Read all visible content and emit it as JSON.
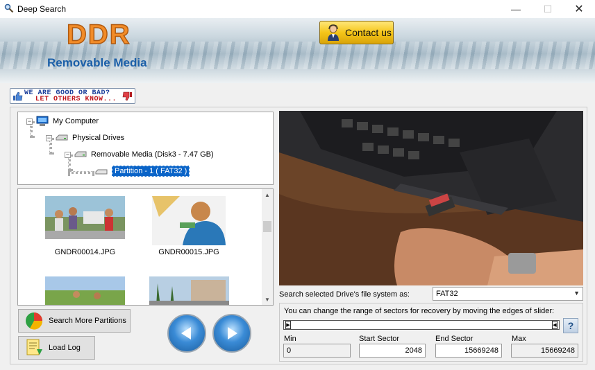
{
  "window": {
    "title": "Deep Search"
  },
  "header": {
    "logo_text": "DDR",
    "product_name": "Removable Media",
    "contact_label": "Contact us"
  },
  "feedback": {
    "line1": "WE ARE GOOD OR BAD?",
    "line2": "LET OTHERS KNOW..."
  },
  "tree": {
    "items": [
      {
        "label": "My Computer"
      },
      {
        "label": "Physical Drives"
      },
      {
        "label": "Removable Media (Disk3 - 7.47 GB)"
      },
      {
        "label": "Partition - 1 ( FAT32 )"
      }
    ]
  },
  "thumbnails": [
    {
      "caption": "GNDR00014.JPG"
    },
    {
      "caption": "GNDR00015.JPG"
    }
  ],
  "buttons": {
    "search_more": "Search More Partitions",
    "load_log": "Load Log"
  },
  "filesystem": {
    "label": "Search selected Drive's file system as:",
    "selected": "FAT32"
  },
  "sector": {
    "hint": "You can change the range of sectors for recovery by moving the edges of slider:",
    "min_label": "Min",
    "min_value": "0",
    "start_label": "Start Sector",
    "start_value": "2048",
    "end_label": "End Sector",
    "end_value": "15669248",
    "max_label": "Max",
    "max_value": "15669248",
    "help_label": "?"
  },
  "colors": {
    "logo": "#f28c28",
    "product": "#1b5fa8",
    "selection": "#0a64c8"
  }
}
